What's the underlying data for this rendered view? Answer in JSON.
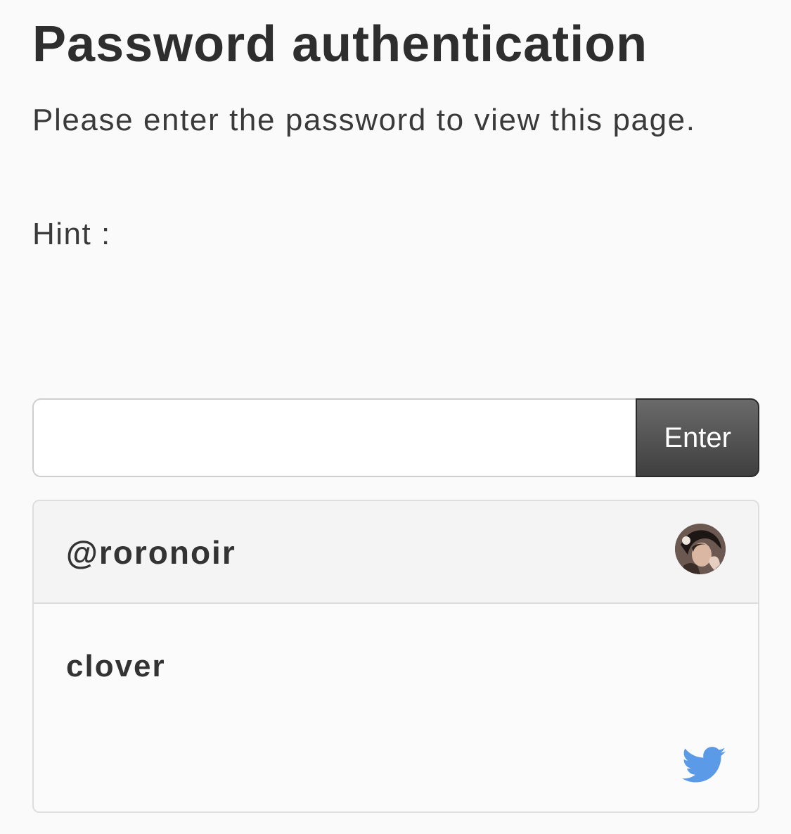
{
  "page": {
    "title": "Password authentication",
    "description": "Please enter the password to view this page.",
    "hint_label": "Hint :"
  },
  "form": {
    "password_value": "",
    "enter_label": "Enter"
  },
  "card": {
    "username": "@roronoir",
    "avatar_icon": "user-avatar",
    "message": "clover",
    "brand_icon": "twitter-bird-icon",
    "brand_color": "#5a9ae6"
  },
  "colors": {
    "background": "#fafafa",
    "text": "#333333",
    "button_dark": "#3f3f3f"
  }
}
